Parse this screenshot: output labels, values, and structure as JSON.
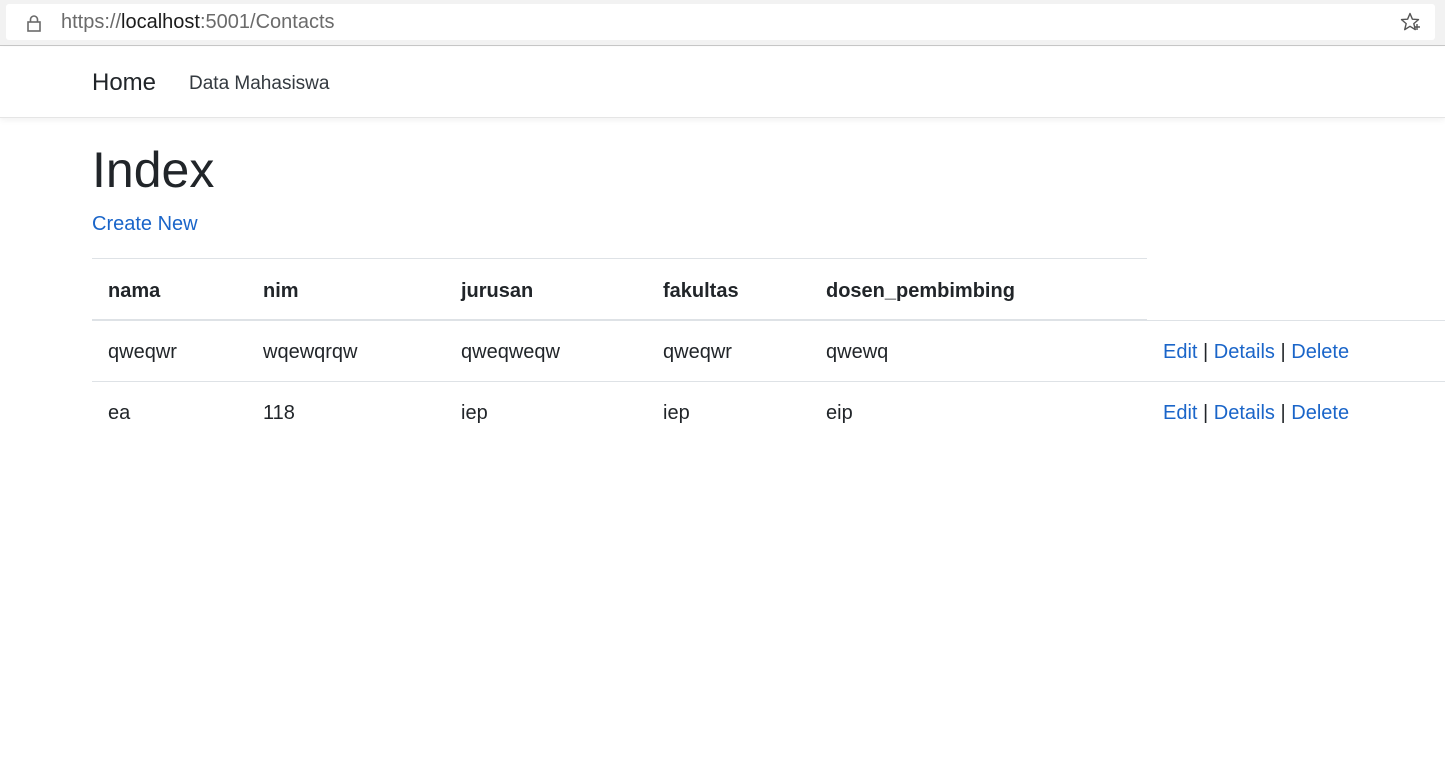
{
  "browser": {
    "url_scheme": "https://",
    "url_host": "localhost",
    "url_rest": ":5001/Contacts"
  },
  "navbar": {
    "brand": "Home",
    "links": [
      "Data Mahasiswa"
    ]
  },
  "page": {
    "title": "Index",
    "create_link": "Create New"
  },
  "table": {
    "headers": [
      "nama",
      "nim",
      "jurusan",
      "fakultas",
      "dosen_pembimbing"
    ],
    "rows": [
      [
        "qweqwr",
        "wqewqrqw",
        "qweqweqw",
        "qweqwr",
        "qwewq"
      ],
      [
        "ea",
        "118",
        "iep",
        "iep",
        "eip"
      ]
    ],
    "actions": {
      "edit": "Edit",
      "details": "Details",
      "delete": "Delete",
      "separator": "|"
    }
  },
  "colors": {
    "link": "#1a65c9",
    "text": "#212529",
    "border": "#dee2e6"
  }
}
